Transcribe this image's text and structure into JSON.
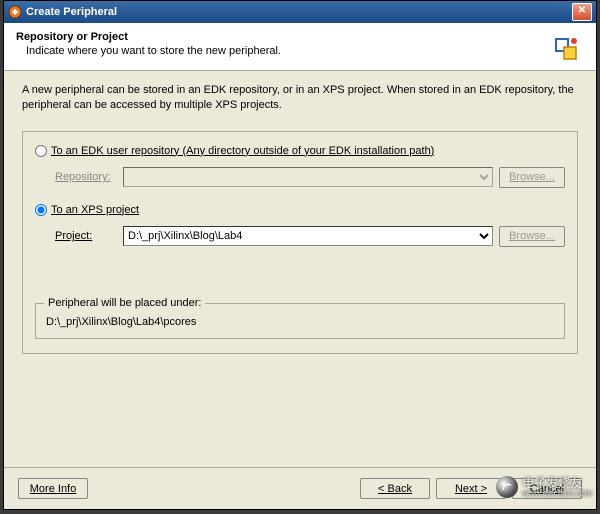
{
  "window": {
    "title": "Create Peripheral"
  },
  "header": {
    "title": "Repository or Project",
    "subtitle": "Indicate where you want to store the new peripheral."
  },
  "intro": "A new peripheral can be stored in an EDK repository, or in an XPS project. When stored in an EDK repository, the peripheral can be accessed by multiple XPS projects.",
  "options": {
    "edk": {
      "label": "To an EDK user repository (Any directory outside of your EDK installation path)",
      "selected": false,
      "field_label": "Repository:",
      "value": "",
      "browse": "Browse..."
    },
    "xps": {
      "label": "To an XPS project",
      "selected": true,
      "field_label": "Project:",
      "value": "D:\\_prj\\Xilinx\\Blog\\Lab4",
      "browse": "Browse..."
    }
  },
  "placed": {
    "legend": "Peripheral will be placed under:",
    "path": "D:\\_prj\\Xilinx\\Blog\\Lab4\\pcores"
  },
  "footer": {
    "more_info": "More Info",
    "back": "< Back",
    "next": "Next >",
    "cancel": "Cancel"
  },
  "watermark": {
    "text": "电子发烧友",
    "url": "www.elecfans.com"
  }
}
